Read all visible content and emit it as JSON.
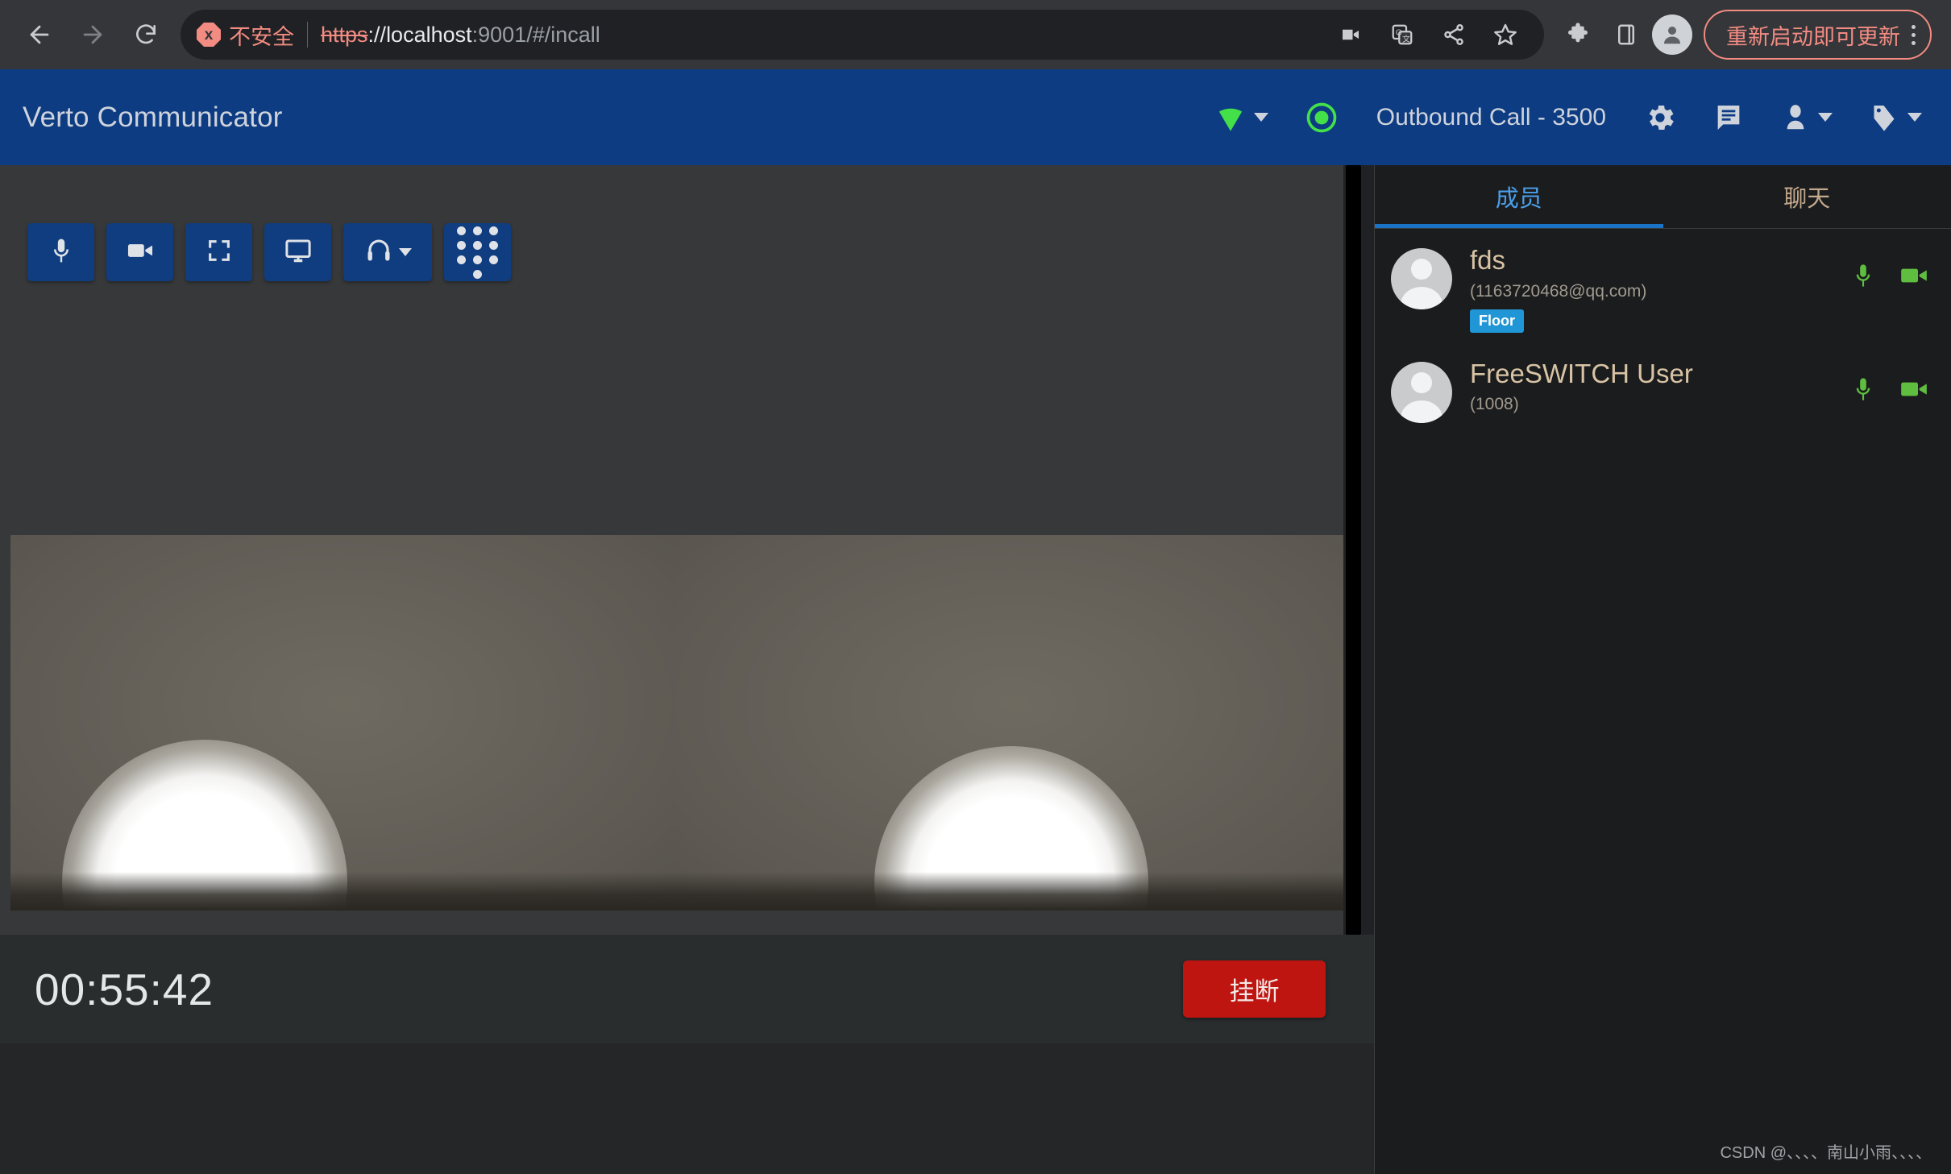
{
  "browser": {
    "back_icon": "back-arrow-icon",
    "forward_icon": "forward-arrow-icon",
    "reload_icon": "reload-icon",
    "security_label": "不安全",
    "security_glyph": "x",
    "url_scheme": "https",
    "url_rest": "://localhost:9001/#/incall",
    "url_host": "localhost",
    "url_port": ":9001",
    "url_path": "/#/incall",
    "omni_icons": [
      "video-capture-icon",
      "translate-icon",
      "share-icon",
      "bookmark-star-icon"
    ],
    "toolbar_icons": [
      "extensions-puzzle-icon",
      "side-panel-icon"
    ],
    "profile_icon": "profile-avatar-icon",
    "update_label": "重新启动即可更新",
    "menu_icon": "kebab-menu-icon"
  },
  "app": {
    "title": "Verto Communicator",
    "signal_icon": "wifi-signal-icon",
    "record_icon": "record-indicator-icon",
    "call_status": "Outbound Call - 3500",
    "settings_icon": "gear-icon",
    "chat_icon": "chat-message-icon",
    "contacts_icon": "person-icon",
    "tag_icon": "tag-icon"
  },
  "video_toolbar": {
    "buttons": [
      {
        "name": "mute-mic-button",
        "icon": "microphone-icon"
      },
      {
        "name": "toggle-camera-button",
        "icon": "video-camera-icon"
      },
      {
        "name": "fullscreen-button",
        "icon": "fullscreen-icon"
      },
      {
        "name": "screen-share-button",
        "icon": "monitor-icon"
      },
      {
        "name": "audio-device-button",
        "icon": "headset-icon"
      },
      {
        "name": "dialpad-button",
        "icon": "dialpad-icon"
      }
    ]
  },
  "call": {
    "duration": "00:55:42",
    "hangup_label": "挂断"
  },
  "sidebar": {
    "tabs": [
      {
        "label": "成员",
        "active": true
      },
      {
        "label": "聊天",
        "active": false
      }
    ],
    "participants": [
      {
        "name": "fds",
        "extension": "(1163720468@qq.com)",
        "badge": "Floor",
        "mic_icon": "microphone-icon",
        "cam_icon": "video-camera-icon"
      },
      {
        "name": "FreeSWITCH User",
        "extension": "(1008)",
        "badge": "",
        "mic_icon": "microphone-icon",
        "cam_icon": "video-camera-icon"
      }
    ]
  },
  "watermark": "CSDN @、、、、南山小雨、、、、",
  "colors": {
    "header_blue": "#0d3c82",
    "button_blue": "#0f3d80",
    "hangup_red": "#bf1511",
    "badge_blue": "#2196d6",
    "tab_active": "#4b9fea",
    "green_accent": "#5fbe40",
    "signal_green": "#44e049",
    "warning_pink": "#f28b82"
  }
}
